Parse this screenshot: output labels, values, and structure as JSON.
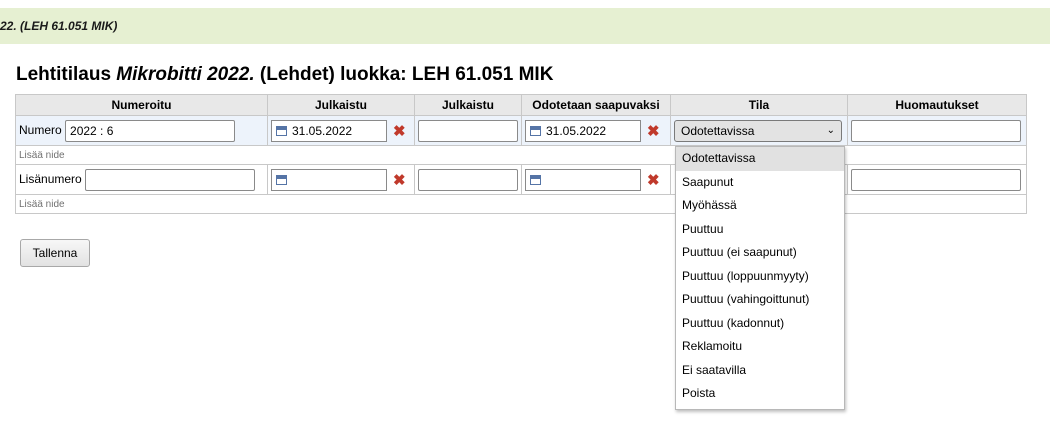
{
  "breadcrumb": "22. (LEH 61.051 MIK)",
  "title": {
    "prefix": "Lehtitilaus ",
    "name": "Mikrobitti 2022.",
    "suffix": " (Lehdet) luokka: LEH 61.051 MIK"
  },
  "table": {
    "headers": [
      "Numeroitu",
      "Julkaistu",
      "Julkaistu",
      "Odotetaan saapuvaksi",
      "Tila",
      "Huomautukset"
    ],
    "row1": {
      "label": "Numero",
      "number_value": "2022 : 6",
      "published_date": "31.05.2022",
      "published_text": "",
      "expected_date": "31.05.2022",
      "status": "Odotettavissa",
      "notes": ""
    },
    "add_volume_1": "Lisää nide",
    "row2": {
      "label": "Lisänumero",
      "number_value": "",
      "published_date": "",
      "published_text": "",
      "expected_date": "",
      "notes": ""
    },
    "add_volume_2": "Lisää nide"
  },
  "save_button": "Tallenna",
  "status_options": [
    "Odotettavissa",
    "Saapunut",
    "Myöhässä",
    "Puuttuu",
    "Puuttuu (ei saapunut)",
    "Puuttuu (loppuunmyyty)",
    "Puuttuu (vahingoittunut)",
    "Puuttuu (kadonnut)",
    "Reklamoitu",
    "Ei saatavilla",
    "Poista"
  ],
  "icons": [
    "calendar-icon",
    "delete-x-icon",
    "chevron-down-icon"
  ],
  "colors": {
    "breadcrumb_bg": "#e6f0d2",
    "delete_red": "#c0392b",
    "row_highlight": "#edf3fb"
  }
}
